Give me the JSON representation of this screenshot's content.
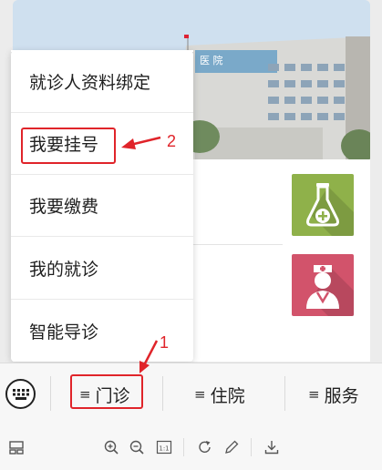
{
  "menu": {
    "items": [
      {
        "label": "就诊人资料绑定"
      },
      {
        "label": "我要挂号"
      },
      {
        "label": "我要缴费"
      },
      {
        "label": "我的就诊"
      },
      {
        "label": "智能导诊"
      }
    ]
  },
  "banner": {
    "sign_text": "医 院"
  },
  "bottom_bar": {
    "tabs": [
      {
        "label": "门诊",
        "icon": "menu-lines-icon"
      },
      {
        "label": "住院",
        "icon": "menu-lines-icon"
      },
      {
        "label": "服务",
        "icon": "menu-lines-icon"
      }
    ],
    "keyboard_icon": "keyboard-icon"
  },
  "annotations": {
    "step1": "1",
    "step2": "2",
    "color": "#e0242a"
  },
  "tiles": [
    {
      "icon": "flask-plus-icon",
      "color": "#8fb14a"
    },
    {
      "icon": "nurse-icon",
      "color": "#d2536b"
    }
  ],
  "toolbar": {
    "icons": [
      "layout-icon",
      "zoom-in-icon",
      "zoom-out-icon",
      "actual-size-icon",
      "rotate-icon",
      "edit-icon",
      "download-icon"
    ],
    "actual_size_label": "1:1"
  }
}
